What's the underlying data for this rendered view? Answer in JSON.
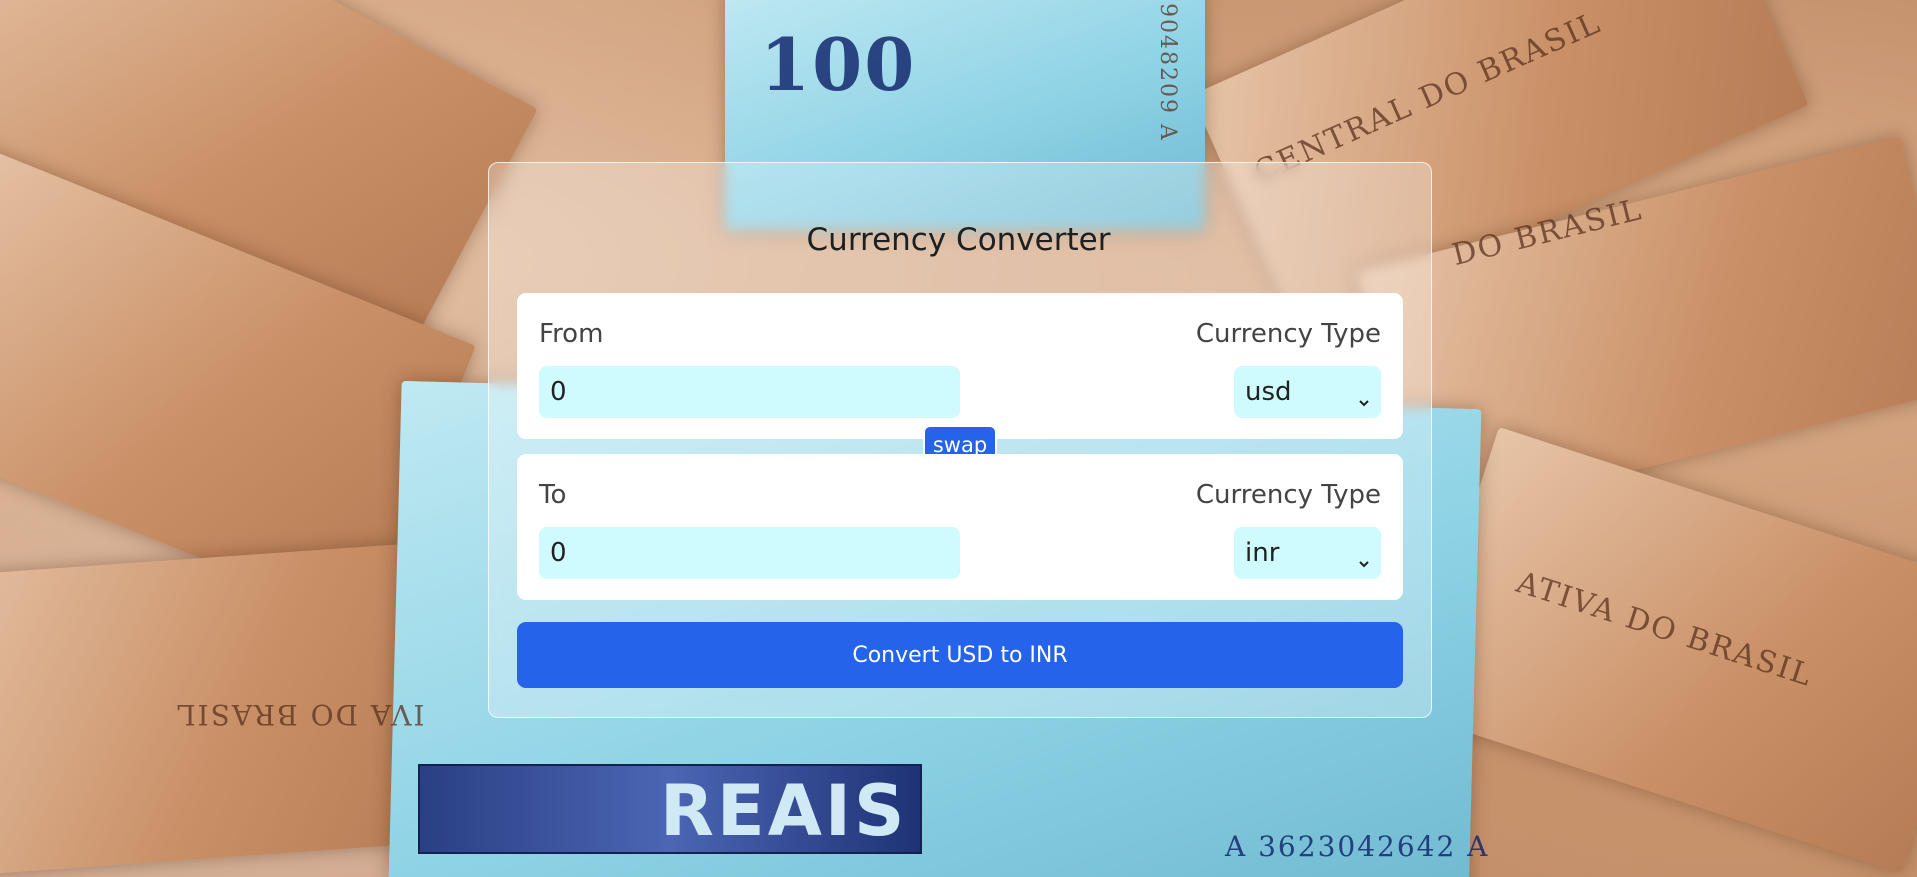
{
  "app": {
    "title": "Currency Converter"
  },
  "from": {
    "label": "From",
    "currency_type_label": "Currency Type",
    "amount": "0",
    "currency": "usd"
  },
  "swap": {
    "label": "swap"
  },
  "to": {
    "label": "To",
    "currency_type_label": "Currency Type",
    "amount": "0",
    "currency": "inr"
  },
  "convert": {
    "label": "Convert USD to INR"
  },
  "background": {
    "note_texts": [
      "100",
      "CENTRAL DO BRASIL",
      "DO BRASIL",
      "ATIVA DO BRASIL",
      "REAIS",
      "A 3623042642 A",
      "IVA DO BRASIL",
      "9048209 A"
    ]
  },
  "colors": {
    "accent": "#2563eb",
    "input_bg": "#cffafe",
    "panel_bg": "#ffffff"
  },
  "icons": {
    "select_arrow": "chevron-down-icon"
  }
}
